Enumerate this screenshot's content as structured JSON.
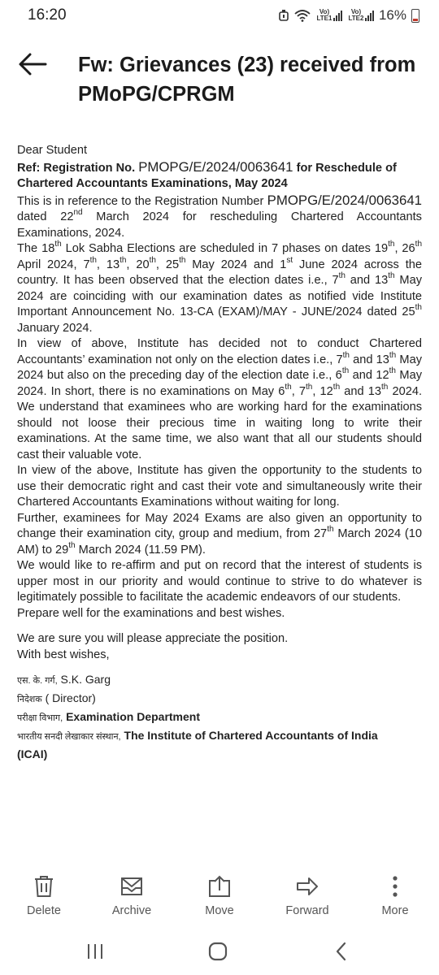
{
  "status": {
    "time": "16:20",
    "sim1": "Vo) LTE1",
    "sim2": "Vo) LTE2",
    "battery": "16%"
  },
  "header": {
    "subject": "Fw: Grievances (23) received from PMoPG/CPRGM"
  },
  "body": {
    "greeting": "Dear Student",
    "ref_prefix": "Ref: Registration No.",
    "reg_no": "PMOPG/E/2024/0063641",
    "ref_suffix": "for Reschedule of Chartered Accountants Examinations, May 2024",
    "p1_a": "This is in reference to the Registration Number",
    "p1_reg": "PMOPG/E/2024/0063641",
    "p1_b": "dated 22",
    "p1_sup": "nd",
    "p1_c": "March 2024 for rescheduling Chartered Accountants Examinations, 2024.",
    "p2": "The 18th Lok Sabha Elections are scheduled in 7 phases on dates 19th, 26th April 2024, 7th, 13th, 20th, 25th May 2024 and 1st June 2024 across the country. It has been observed that the election dates i.e., 7th and 13th May 2024 are coinciding with our examination dates as notified vide Institute Important Announcement No. 13-CA (EXAM)/MAY - JUNE/2024 dated 25th January 2024.",
    "p3": "In view of above, Institute has decided not to conduct Chartered Accountants’ examination not only on the election dates i.e., 7th and 13th May 2024 but also on the preceding day of the election date i.e., 6th and 12th May 2024. In short, there is no examinations on May 6th, 7th, 12th and 13th 2024. We understand that examinees who are working hard for the examinations should not loose their precious time in waiting long to write their examinations. At the same time, we also want that all our students should cast their valuable vote.",
    "p4": "In view of the above, Institute has given the opportunity to the students to use their democratic right and cast their vote and simultaneously write their Chartered Accountants Examinations without waiting for long.",
    "p5": "Further, examinees for May 2024 Exams are also given an opportunity to change their examination city, group and medium, from 27th March 2024 (10 AM) to 29th March 2024 (11.59 PM).",
    "p6": "We would like to re-affirm and put on record that the interest of students is upper most in our priority and would continue to strive to do whatever is legitimately possible to facilitate the academic endeavors of our students.",
    "p7": "Prepare well for the examinations and best wishes.",
    "p8": "We are sure you will please appreciate the position.",
    "closing": "With best wishes,",
    "sig_name_hi": "एस. के. गर्ग,",
    "sig_name": "S.K. Garg",
    "sig_title_hi": "निदेशक",
    "sig_title": "( Director)",
    "sig_dept_hi": "परीक्षा विभाग,",
    "sig_dept": "Examination Department",
    "sig_org_hi": "भारतीय सनदी लेखाकार संस्थान,",
    "sig_org": "The Institute of Chartered Accountants of India",
    "sig_abbr": "(ICAI)"
  },
  "actions": [
    {
      "label": "Delete",
      "icon": "trash-icon"
    },
    {
      "label": "Archive",
      "icon": "archive-icon"
    },
    {
      "label": "Move",
      "icon": "move-icon"
    },
    {
      "label": "Forward",
      "icon": "forward-icon"
    },
    {
      "label": "More",
      "icon": "more-vertical-icon"
    }
  ],
  "nav": {
    "recents_icon": "recents-icon",
    "home_icon": "home-icon",
    "back_icon": "back-icon"
  },
  "colors": {
    "text": "#222222",
    "icon": "#555555"
  }
}
